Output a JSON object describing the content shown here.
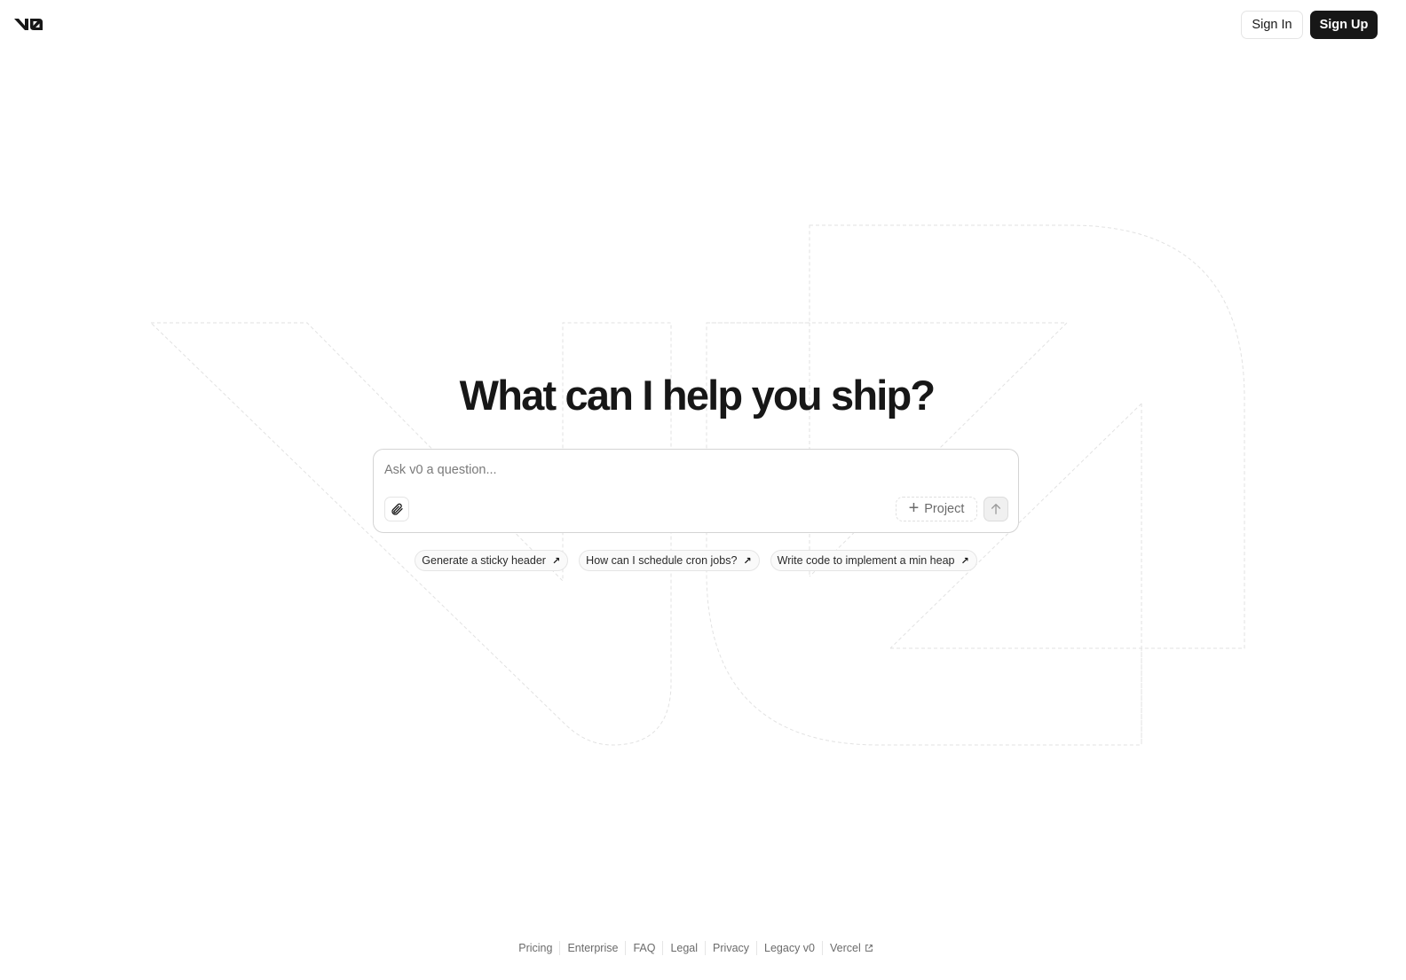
{
  "header": {
    "logo_alt": "v0",
    "sign_in_label": "Sign In",
    "sign_up_label": "Sign Up"
  },
  "hero": {
    "title": "What can I help you ship?"
  },
  "prompt": {
    "placeholder": "Ask v0 a question...",
    "value": "",
    "attach_icon": "paperclip-icon",
    "project_label": "Project",
    "project_icon": "plus-icon",
    "send_icon": "arrow-up-icon"
  },
  "suggestions": [
    {
      "label": "Generate a sticky header",
      "icon": "arrow-up-right-icon"
    },
    {
      "label": "How can I schedule cron jobs?",
      "icon": "arrow-up-right-icon"
    },
    {
      "label": "Write code to implement a min heap",
      "icon": "arrow-up-right-icon"
    }
  ],
  "footer": {
    "links": [
      {
        "label": "Pricing"
      },
      {
        "label": "Enterprise"
      },
      {
        "label": "FAQ"
      },
      {
        "label": "Legal"
      },
      {
        "label": "Privacy"
      },
      {
        "label": "Legacy v0"
      },
      {
        "label": "Vercel",
        "icon": "external-link-icon"
      }
    ]
  },
  "colors": {
    "primary": "#171717",
    "background": "#ffffff",
    "border": "#e5e5e5",
    "muted_text": "#6b6b6b"
  }
}
